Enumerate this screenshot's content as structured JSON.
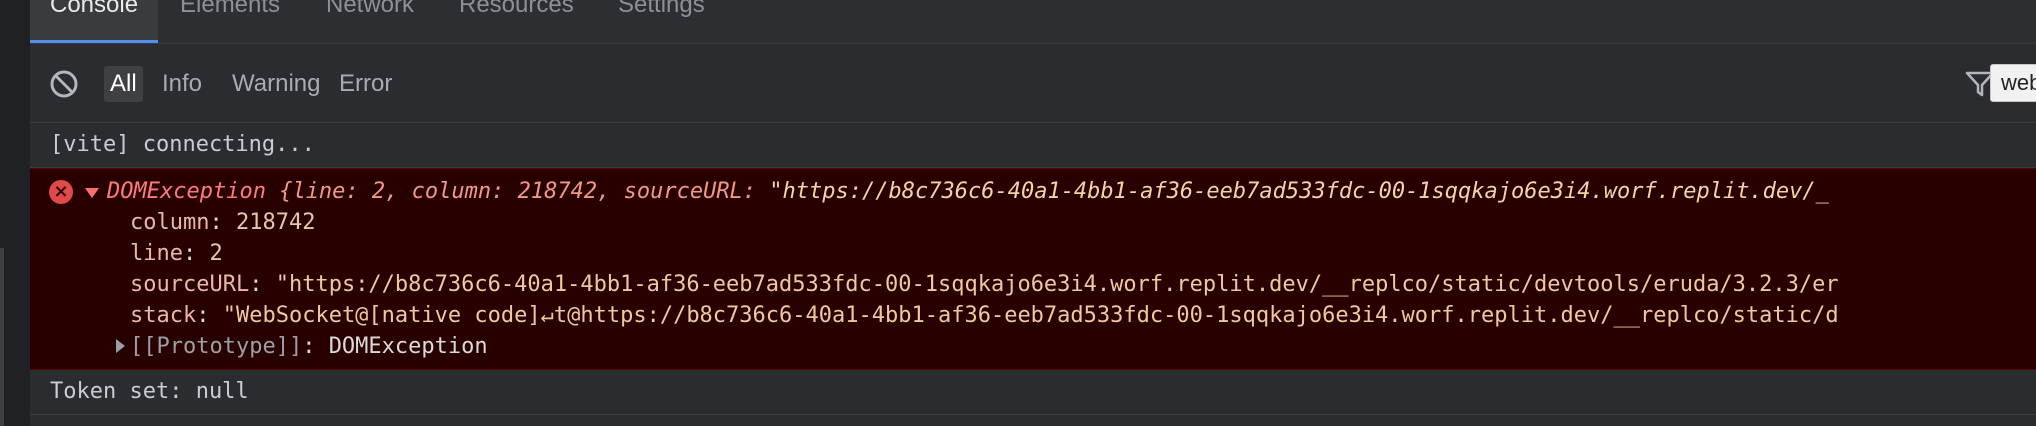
{
  "tabs": [
    "Console",
    "Elements",
    "Network",
    "Resources",
    "Settings"
  ],
  "toolbar": {
    "filters": [
      "All",
      "Info",
      "Warning",
      "Error"
    ],
    "tooltip": "webview"
  },
  "console": {
    "lines": [
      "[vite] connecting..."
    ],
    "error": {
      "head_name": "DOMException",
      "head_open": " {line: ",
      "head_line": "2",
      "head_mid1": ", column: ",
      "head_column": "218742",
      "head_mid2": ", sourceURL: ",
      "head_url": "\"https://b8c736c6-40a1-4bb1-af36-eeb7ad533fdc-00-1sqqkajo6e3i4.worf.replit.dev/_",
      "column_key": "column",
      "column_val": "218742",
      "line_key": "line",
      "line_val": "2",
      "source_key": "sourceURL",
      "source_val": "\"https://b8c736c6-40a1-4bb1-af36-eeb7ad533fdc-00-1sqqkajo6e3i4.worf.replit.dev/__replco/static/devtools/eruda/3.2.3/er",
      "stack_key": "stack",
      "stack_val": "\"WebSocket@[native code]↵t@https://b8c736c6-40a1-4bb1-af36-eeb7ad533fdc-00-1sqqkajo6e3i4.worf.replit.dev/__replco/static/d",
      "proto_key": "[[Prototype]]",
      "proto_val": "DOMException"
    },
    "footer": "Token set: null"
  },
  "icons": {
    "clear": "clear-icon",
    "filter": "funnel-icon",
    "copy": "copy-icon",
    "error": "error-icon"
  },
  "colors": {
    "accent": "#4f8ff0",
    "error_bg": "#290000",
    "error_text": "#ff7a7a"
  }
}
